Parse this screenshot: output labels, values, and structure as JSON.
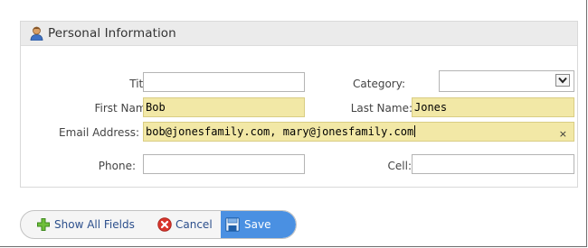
{
  "panel": {
    "title": "Personal Information",
    "icon": "person-icon"
  },
  "form": {
    "title": {
      "label": "Title:",
      "value": ""
    },
    "category": {
      "label": "Category:",
      "value": "",
      "icon": "dropdown-arrow-icon"
    },
    "first_name": {
      "label": "First Name:",
      "value": "Bob"
    },
    "last_name": {
      "label": "Last Name:",
      "value": "Jones"
    },
    "email": {
      "label": "Email Address:",
      "value": "bob@jonesfamily.com, mary@jonesfamily.com",
      "clear": "×"
    },
    "phone": {
      "label": "Phone:",
      "value": ""
    },
    "cell": {
      "label": "Cell:",
      "value": ""
    }
  },
  "actions": {
    "show_all": {
      "label": "Show All Fields",
      "icon": "green-plus-icon"
    },
    "cancel": {
      "label": "Cancel",
      "icon": "red-cancel-icon"
    },
    "save": {
      "label": "Save",
      "icon": "floppy-disk-icon"
    }
  },
  "colors": {
    "filled_field": "#f2e8a6",
    "save_button": "#4a90e2",
    "link_text": "#2c4f8c"
  }
}
